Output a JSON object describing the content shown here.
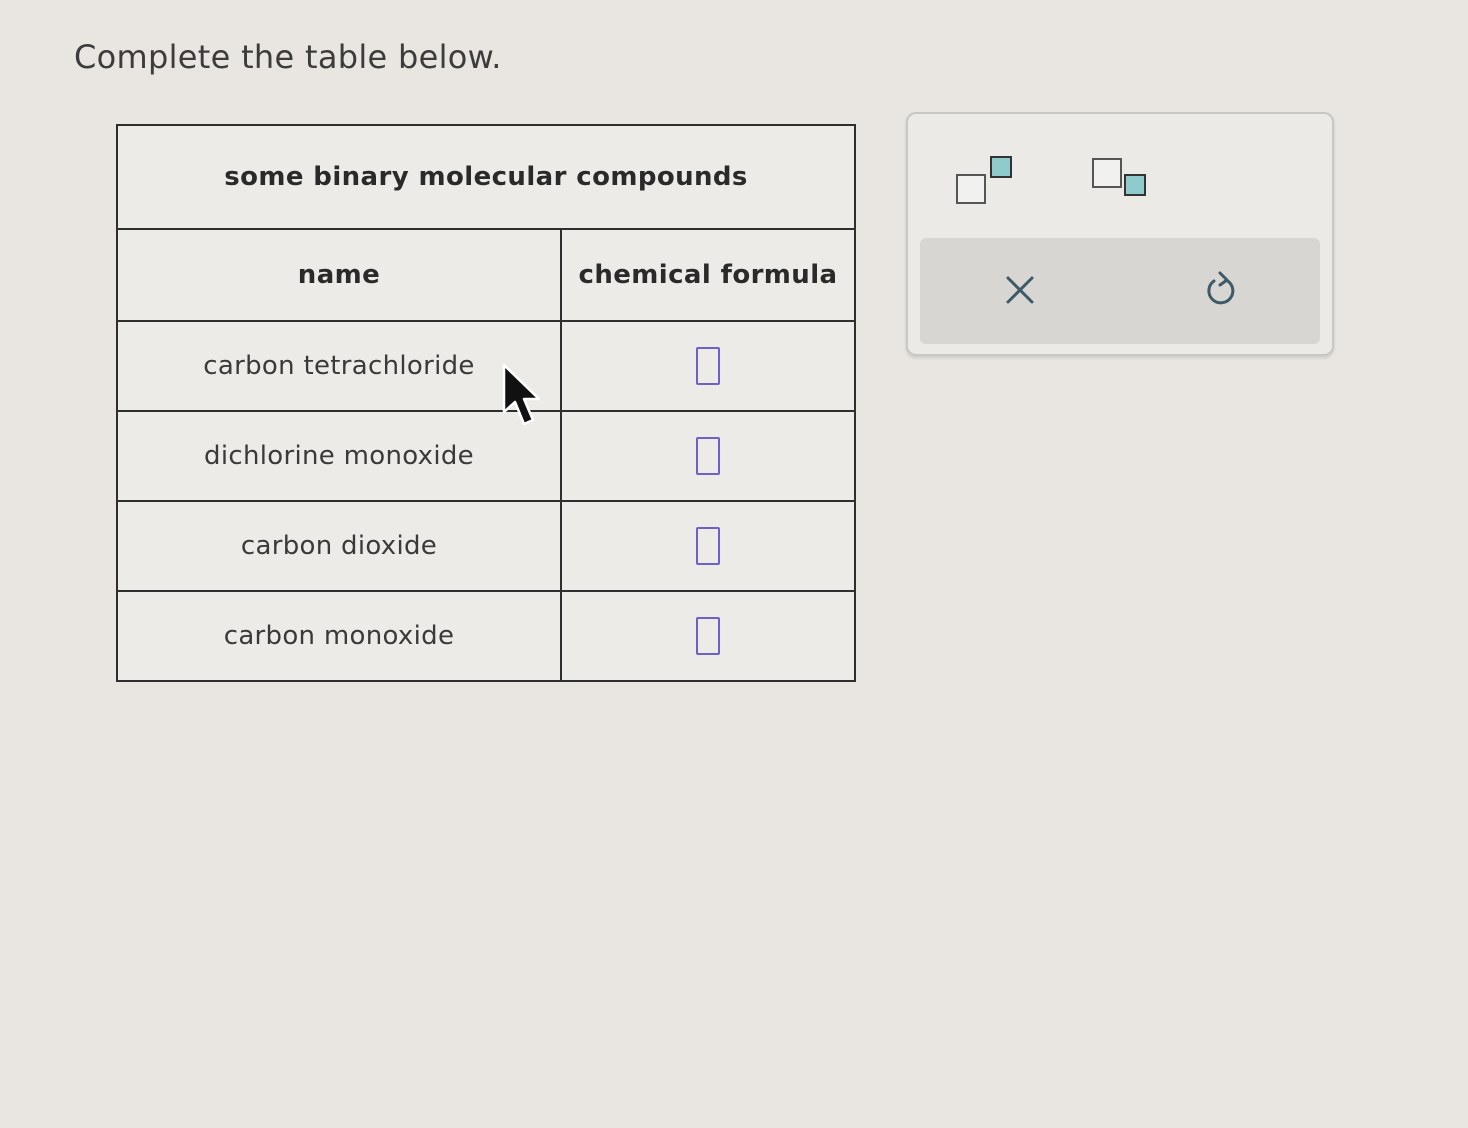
{
  "instruction": "Complete the table below.",
  "table": {
    "caption": "some binary molecular compounds",
    "headers": {
      "name": "name",
      "formula": "chemical formula"
    },
    "rows": [
      {
        "name": "carbon tetrachloride",
        "formula": ""
      },
      {
        "name": "dichlorine monoxide",
        "formula": ""
      },
      {
        "name": "carbon dioxide",
        "formula": ""
      },
      {
        "name": "carbon monoxide",
        "formula": ""
      }
    ]
  },
  "toolbar": {
    "superscript_icon": "superscript-box-icon",
    "subscript_icon": "subscript-box-icon",
    "clear_glyph": "×",
    "undo_icon": "undo-icon"
  },
  "colors": {
    "input_border": "#6f5fc8",
    "template_box_fill": "#8fcbcc",
    "action_bar": "#d7d6d3"
  }
}
